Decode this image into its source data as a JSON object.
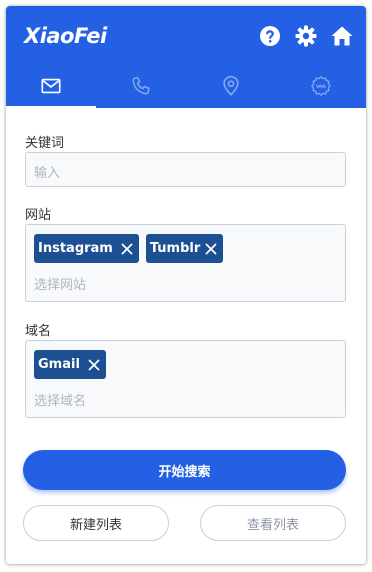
{
  "header": {
    "logo": "XiaoFei",
    "icons": [
      "help-icon",
      "gear-icon",
      "home-icon"
    ]
  },
  "tabs": [
    {
      "icon": "mail-icon",
      "active": true
    },
    {
      "icon": "phone-icon",
      "active": false
    },
    {
      "icon": "location-pin-icon",
      "active": false
    },
    {
      "icon": "www-badge-icon",
      "active": false
    }
  ],
  "form": {
    "keyword": {
      "label": "关键词",
      "placeholder": "输入",
      "value": ""
    },
    "website": {
      "label": "网站",
      "tags": [
        "Instagram",
        "Tumblr"
      ],
      "placeholder": "选择网站"
    },
    "domain": {
      "label": "域名",
      "tags": [
        "Gmail"
      ],
      "placeholder": "选择域名"
    }
  },
  "actions": {
    "search_label": "开始搜索",
    "new_list_label": "新建列表",
    "view_list_label": "查看列表"
  },
  "colors": {
    "brand": "#2460e4",
    "tag": "#1d4f93",
    "disabled_text": "#8c96a6"
  }
}
